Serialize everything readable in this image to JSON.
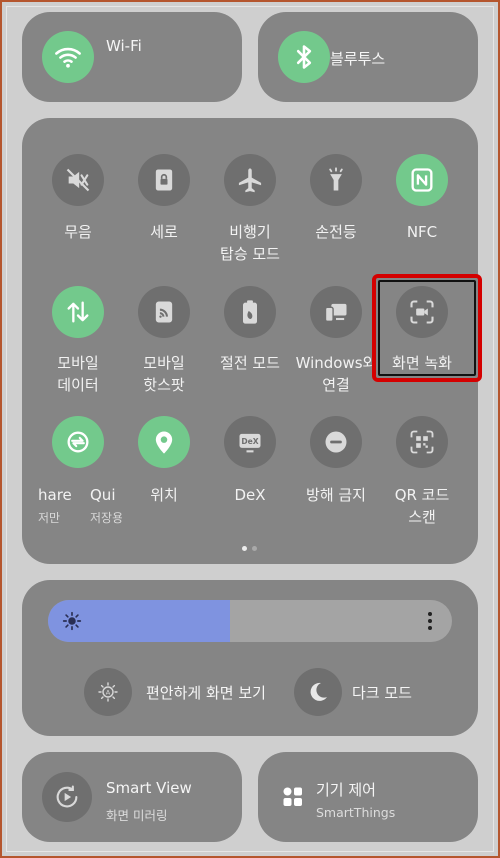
{
  "top_tiles": {
    "wifi": {
      "label": "Wi-Fi",
      "icon": "wifi-icon",
      "on": true
    },
    "bluetooth": {
      "label": "블루투스",
      "icon": "bluetooth-icon",
      "on": true
    }
  },
  "quick_toggles": [
    {
      "line1": "무음",
      "line2": "",
      "icon": "mute-icon",
      "on": false
    },
    {
      "line1": "세로",
      "line2": "",
      "icon": "portrait-lock-icon",
      "on": false
    },
    {
      "line1": "비행기",
      "line2": "탑승 모드",
      "icon": "airplane-icon",
      "on": false
    },
    {
      "line1": "손전등",
      "line2": "",
      "icon": "flashlight-icon",
      "on": false
    },
    {
      "line1": "NFC",
      "line2": "",
      "icon": "nfc-icon",
      "on": true
    },
    {
      "line1": "모바일",
      "line2": "데이터",
      "icon": "mobile-data-icon",
      "on": true
    },
    {
      "line1": "모바일",
      "line2": "핫스팟",
      "icon": "hotspot-icon",
      "on": false
    },
    {
      "line1": "절전 모드",
      "line2": "",
      "icon": "battery-saver-icon",
      "on": false
    },
    {
      "line1": "Windows와",
      "line2": "연결",
      "icon": "link-to-windows-icon",
      "on": false
    },
    {
      "line1": "화면 녹화",
      "line2": "",
      "icon": "screen-recorder-icon",
      "on": false
    },
    {
      "line1": "hare",
      "line2": "저만",
      "line3": "Qui",
      "line4": "저장용",
      "icon": "quick-share-icon",
      "on": true
    },
    {
      "line1": "위치",
      "line2": "",
      "icon": "location-icon",
      "on": true
    },
    {
      "line1": "DeX",
      "line2": "",
      "icon": "dex-icon",
      "on": false
    },
    {
      "line1": "방해 금지",
      "line2": "",
      "icon": "do-not-disturb-icon",
      "on": false
    },
    {
      "line1": "QR 코드",
      "line2": "스캔",
      "icon": "qr-scan-icon",
      "on": false
    }
  ],
  "page_indicator": {
    "total": 2,
    "current": 1
  },
  "brightness": {
    "level": 0.45,
    "color": "#7f93e0"
  },
  "display_modes": {
    "eye_comfort": "편안하게 화면 보기",
    "dark_mode": "다크 모드"
  },
  "bottom_tiles": {
    "smart_view": {
      "title": "Smart View",
      "subtitle": "화면 미러링"
    },
    "device_control": {
      "title": "기기 제어",
      "subtitle": "SmartThings"
    }
  },
  "colors": {
    "accent_green": "#73c98c",
    "highlight_red": "#d40000"
  }
}
